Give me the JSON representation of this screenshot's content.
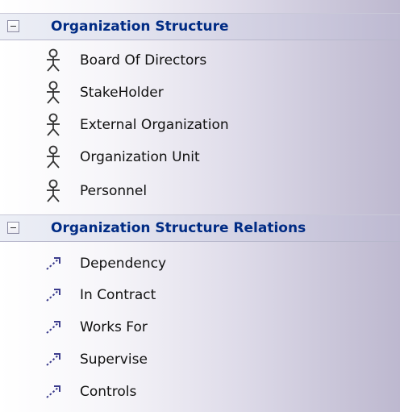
{
  "groups": [
    {
      "title": "Organization Structure",
      "items": [
        {
          "label": "Board Of Directors",
          "icon": "actor-icon"
        },
        {
          "label": "StakeHolder",
          "icon": "actor-icon"
        },
        {
          "label": "External Organization",
          "icon": "actor-icon"
        },
        {
          "label": "Organization Unit",
          "icon": "actor-icon"
        },
        {
          "label": "Personnel",
          "icon": "actor-icon"
        }
      ]
    },
    {
      "title": "Organization Structure Relations",
      "items": [
        {
          "label": "Dependency",
          "icon": "dashed-arrow-icon"
        },
        {
          "label": "In Contract",
          "icon": "dashed-arrow-icon"
        },
        {
          "label": "Works For",
          "icon": "dashed-arrow-icon"
        },
        {
          "label": "Supervise",
          "icon": "dashed-arrow-icon"
        },
        {
          "label": "Controls",
          "icon": "dashed-arrow-icon"
        }
      ]
    }
  ],
  "colors": {
    "header_text": "#002b84",
    "item_text": "#111111",
    "icon_stroke": "#333333",
    "relation_icon": "#3b3b8c"
  }
}
